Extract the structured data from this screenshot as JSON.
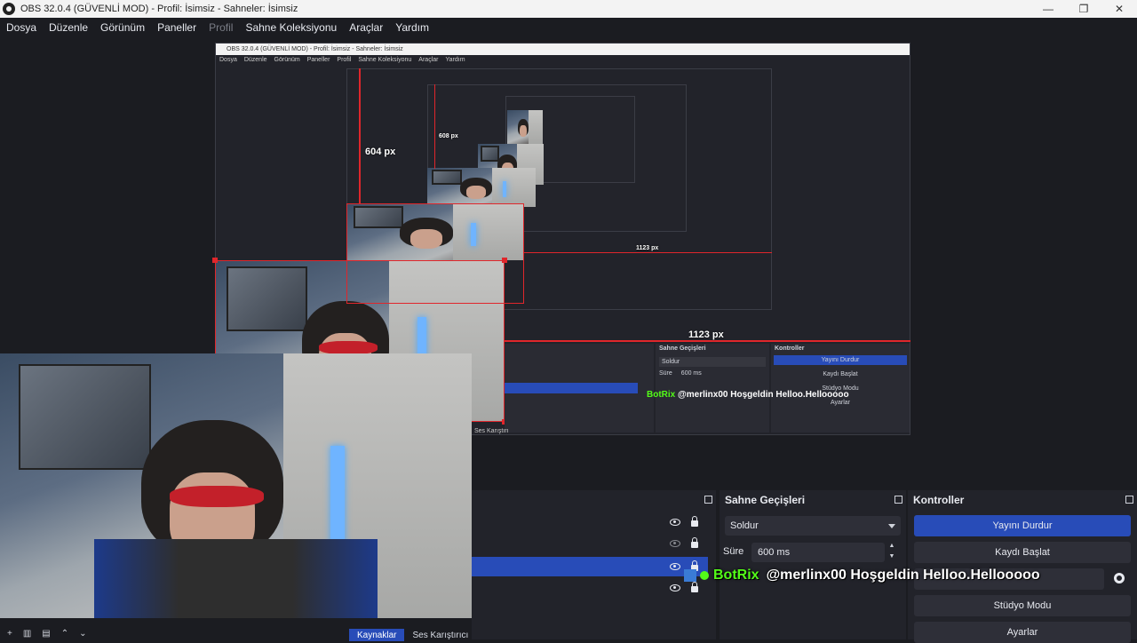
{
  "window": {
    "title": "OBS 32.0.4 (GÜVENLİ MOD) - Profil: İsimsiz - Sahneler: İsimsiz",
    "controls": [
      "—",
      "❐",
      "✕"
    ]
  },
  "menu": [
    "Dosya",
    "Düzenle",
    "Görünüm",
    "Paneller",
    "Profil",
    "Sahne Koleksiyonu",
    "Araçlar",
    "Yardım"
  ],
  "preview": {
    "measure_604": "604 px",
    "measure_608": "608 px",
    "measure_1123_small": "1123 px",
    "measure_1123": "1123 px",
    "mini_title": "OBS 32.0.4 (GÜVENLİ MOD) - Profil: İsimsiz - Sahneler: İsimsiz",
    "mini_menu": [
      "Dosya",
      "Düzenle",
      "Görünüm",
      "Paneller",
      "Profil",
      "Sahne Koleksiyonu",
      "Araçlar",
      "Yardım"
    ],
    "mini_transitions_title": "Sahne Geçişleri",
    "mini_controls_title": "Kontroller",
    "mini_stop_stream": "Yayını Durdur",
    "mini_start_record": "Kaydı Başlat",
    "mini_studio": "Stüdyo Modu",
    "mini_settings": "Ayarlar",
    "mini_fade": "Soldur",
    "mini_duration_label": "Süre",
    "mini_duration": "600 ms",
    "mini_mixer_tab": "Ses Karıştırı",
    "mini_chat_user": "BotRix",
    "mini_chat_msg": "@merlinx00 Hoşgeldin Helloo.Hellooooo"
  },
  "transitions": {
    "title": "Sahne Geçişleri",
    "selected": "Soldur",
    "duration_label": "Süre",
    "duration_value": "600 ms"
  },
  "controls": {
    "title": "Kontroller",
    "stop_stream": "Yayını Durdur",
    "start_record": "Kaydı Başlat",
    "studio_mode": "Stüdyo Modu",
    "settings": "Ayarlar"
  },
  "chat": {
    "user": "BotRix",
    "message": "@merlinx00 Hoşgeldin Helloo.Hellooooo"
  },
  "tabs": [
    "Kaynaklar",
    "Ses Karıştırıcı"
  ]
}
